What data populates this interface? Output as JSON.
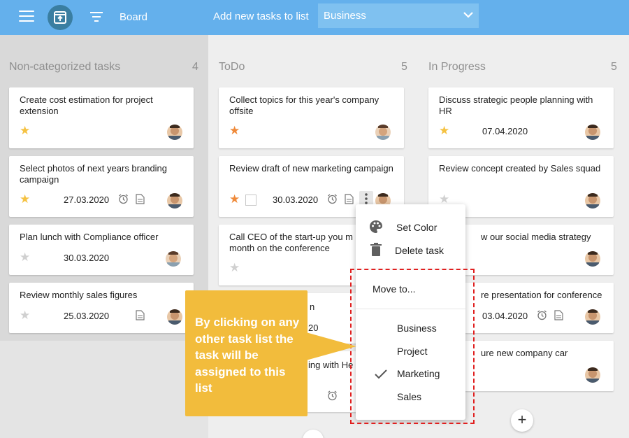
{
  "topbar": {
    "board_label": "Board",
    "add_label": "Add new tasks to list",
    "list_select": "Business"
  },
  "columns": [
    {
      "name": "Non-categorized tasks",
      "count": "4",
      "cards": [
        {
          "title": "Create cost estimation for project extension",
          "date": ""
        },
        {
          "title": "Select photos of next years branding campaign",
          "date": "27.03.2020"
        },
        {
          "title": "Plan lunch with Compliance officer",
          "date": "30.03.2020"
        },
        {
          "title": "Review monthly sales figures",
          "date": "25.03.2020"
        }
      ]
    },
    {
      "name": "ToDo",
      "count": "5",
      "cards": [
        {
          "title": "Collect topics for this year's company offsite",
          "date": ""
        },
        {
          "title": "Review draft of new marketing campaign",
          "date": "30.03.2020"
        },
        {
          "title": "Call CEO of the start-up you m month on the conference",
          "date": ""
        },
        {
          "title": "n",
          "date": "20"
        },
        {
          "title": "ing with He",
          "date": ""
        }
      ]
    },
    {
      "name": "In Progress",
      "count": "5",
      "cards": [
        {
          "title": "Discuss strategic people planning with HR",
          "date": "07.04.2020"
        },
        {
          "title": "Review concept created by Sales squad",
          "date": ""
        },
        {
          "title": "w our social media strategy",
          "date": ""
        },
        {
          "title": "re presentation for conference",
          "date": "03.04.2020"
        },
        {
          "title": "ure new company car",
          "date": ""
        }
      ]
    }
  ],
  "menu": {
    "set_color": "Set Color",
    "delete_task": "Delete task",
    "move_to": "Move to...",
    "lists": [
      "Business",
      "Project",
      "Marketing",
      "Sales"
    ],
    "checked": "Marketing"
  },
  "callout": {
    "text": "By clicking on any other task list the task will be assigned to this list"
  },
  "colors": {
    "topbar": "#64b0ec",
    "callout": "#f2bc3c",
    "highlight_border": "#e02020"
  }
}
